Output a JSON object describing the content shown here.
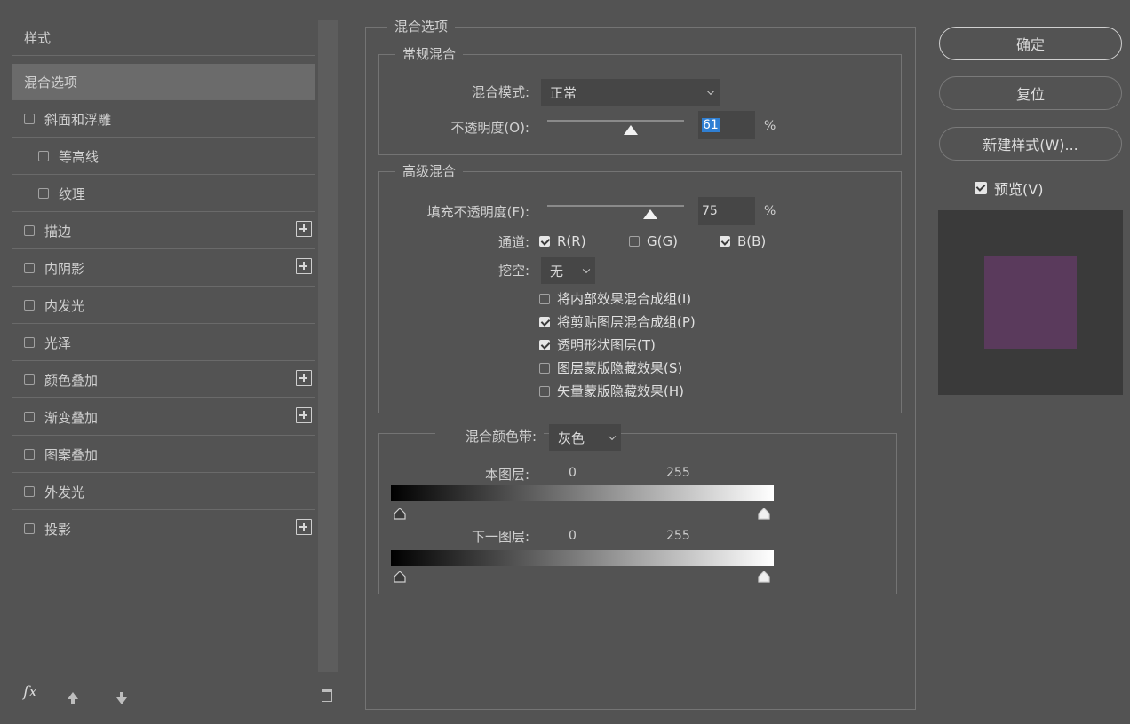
{
  "left": {
    "header": "样式",
    "items": [
      {
        "label": "混合选项",
        "checkbox": false,
        "selected": true,
        "plus": false
      },
      {
        "label": "斜面和浮雕",
        "checkbox": true,
        "checked": false,
        "plus": false
      },
      {
        "label": "等高线",
        "checkbox": true,
        "checked": false,
        "plus": false,
        "indent": true
      },
      {
        "label": "纹理",
        "checkbox": true,
        "checked": false,
        "plus": false,
        "indent": true
      },
      {
        "label": "描边",
        "checkbox": true,
        "checked": false,
        "plus": true
      },
      {
        "label": "内阴影",
        "checkbox": true,
        "checked": false,
        "plus": true
      },
      {
        "label": "内发光",
        "checkbox": true,
        "checked": false,
        "plus": false
      },
      {
        "label": "光泽",
        "checkbox": true,
        "checked": false,
        "plus": false
      },
      {
        "label": "颜色叠加",
        "checkbox": true,
        "checked": false,
        "plus": true
      },
      {
        "label": "渐变叠加",
        "checkbox": true,
        "checked": false,
        "plus": true
      },
      {
        "label": "图案叠加",
        "checkbox": true,
        "checked": false,
        "plus": false
      },
      {
        "label": "外发光",
        "checkbox": true,
        "checked": false,
        "plus": false
      },
      {
        "label": "投影",
        "checkbox": true,
        "checked": false,
        "plus": true
      }
    ],
    "fx_label": "fx"
  },
  "blend": {
    "title": "混合选项",
    "general": {
      "title": "常规混合",
      "mode_label": "混合模式:",
      "mode_value": "正常",
      "opacity_label": "不透明度(O):",
      "opacity_value": "61",
      "opacity_level": 61,
      "pct": "%"
    },
    "advanced": {
      "title": "高级混合",
      "fill_label": "填充不透明度(F):",
      "fill_value": "75",
      "fill_level": 75,
      "pct": "%",
      "channels_label": "通道:",
      "channels": [
        {
          "label": "R(R)",
          "checked": true
        },
        {
          "label": "G(G)",
          "checked": false
        },
        {
          "label": "B(B)",
          "checked": true
        }
      ],
      "knockout_label": "挖空:",
      "knockout_value": "无",
      "options": [
        {
          "label": "将内部效果混合成组(I)",
          "checked": false
        },
        {
          "label": "将剪贴图层混合成组(P)",
          "checked": true
        },
        {
          "label": "透明形状图层(T)",
          "checked": true
        },
        {
          "label": "图层蒙版隐藏效果(S)",
          "checked": false
        },
        {
          "label": "矢量蒙版隐藏效果(H)",
          "checked": false
        }
      ]
    },
    "blend_if": {
      "label": "混合颜色带:",
      "value": "灰色",
      "this_layer_label": "本图层:",
      "this_layer_min": "0",
      "this_layer_max": "255",
      "underlying_label": "下一图层:",
      "underlying_min": "0",
      "underlying_max": "255"
    }
  },
  "right": {
    "ok_label": "确定",
    "reset_label": "复位",
    "new_style_label": "新建样式(W)...",
    "preview_label": "预览(V)",
    "preview_checked": true,
    "swatch_color": "#5a3a5c"
  }
}
